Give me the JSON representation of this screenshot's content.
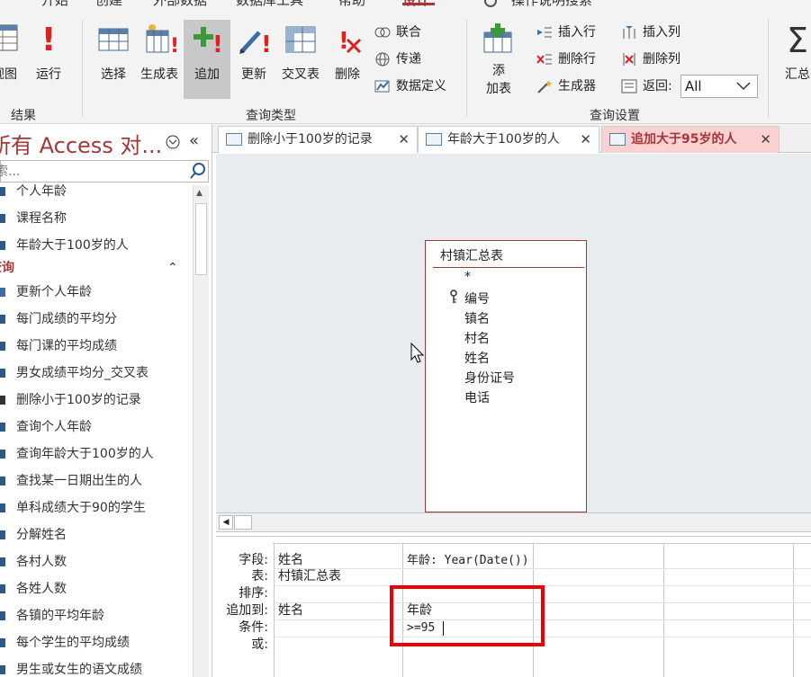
{
  "ribbon": {
    "tabs": [
      "开始",
      "创建",
      "外部数据",
      "数据库工具",
      "帮助",
      "设计",
      "操作说明搜索"
    ],
    "active_tab": "设计",
    "buttons": {
      "view": "视图",
      "run": "运行",
      "select": "选择",
      "make_table": "生成表",
      "append": "追加",
      "update": "更新",
      "crosstab": "交叉表",
      "delete": "删除",
      "union": "联合",
      "pass_through": "传递",
      "data_definition": "数据定义",
      "add_table_top": "添",
      "add_table_bottom": "加表",
      "insert_rows": "插入行",
      "delete_rows": "删除行",
      "builder": "生成器",
      "insert_columns": "插入列",
      "delete_columns": "删除列",
      "return_label": "返回:",
      "return_value": "All",
      "totals": "汇总"
    },
    "groups": {
      "results": "结果",
      "query_type": "查询类型",
      "query_setup": "查询设置"
    }
  },
  "nav": {
    "title": "所有 Access 对...",
    "search_placeholder": "搜索...",
    "items_top": [
      "个人年龄",
      "课程名称",
      "年龄大于100岁的人"
    ],
    "group_label": "查询",
    "queries": [
      "更新个人年龄",
      "每门成绩的平均分",
      "每门课的平均成绩",
      "男女成绩平均分_交叉表",
      "删除小于100岁的记录",
      "查询个人年龄",
      "查询年龄大于100岁的人",
      "查找某一日期出生的人",
      "单科成绩大于90的学生",
      "分解姓名",
      "各村人数",
      "各姓人数",
      "各镇的平均年龄",
      "每个学生的平均成绩",
      "男生或女生的语文成绩"
    ]
  },
  "doc_tabs": [
    {
      "label": "删除小于100岁的记录",
      "active": false
    },
    {
      "label": "年龄大于100岁的人",
      "active": false
    },
    {
      "label": "追加大于95岁的人",
      "active": true
    }
  ],
  "table": {
    "title": "村镇汇总表",
    "fields": [
      "*",
      "编号",
      "镇名",
      "村名",
      "姓名",
      "身份证号",
      "电话"
    ]
  },
  "grid": {
    "row_labels": [
      "字段:",
      "表:",
      "排序:",
      "追加到:",
      "条件:",
      "或:"
    ],
    "col1": {
      "field": "姓名",
      "table": "村镇汇总表",
      "append_to": "姓名"
    },
    "col2": {
      "field": "年龄: Year(Date())",
      "append_to": "年龄",
      "criteria": ">=95"
    }
  },
  "colors": {
    "accent": "#a4373a",
    "highlight_box": "#ee0000"
  }
}
